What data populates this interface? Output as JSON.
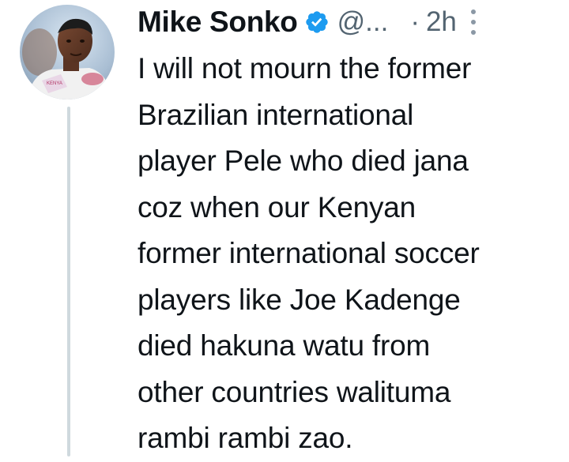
{
  "tweet": {
    "author": {
      "name": "Mike Sonko",
      "handle": "@...",
      "verified": true,
      "avatar_icon": "profile-photo"
    },
    "separator": "·",
    "timestamp": "2h",
    "more_icon": "more-options-icon",
    "text": "I will not mourn the former\nBrazilian international\nplayer Pele who died jana\ncoz when our Kenyan\nformer international soccer\nplayers like Joe Kadenge\ndied hakuna watu from\nother countries walituma\nrambi rambi zao."
  },
  "colors": {
    "text_primary": "#0f1419",
    "text_secondary": "#536471",
    "verified_blue": "#1d9bf0",
    "thread_line": "#cfd9de"
  }
}
